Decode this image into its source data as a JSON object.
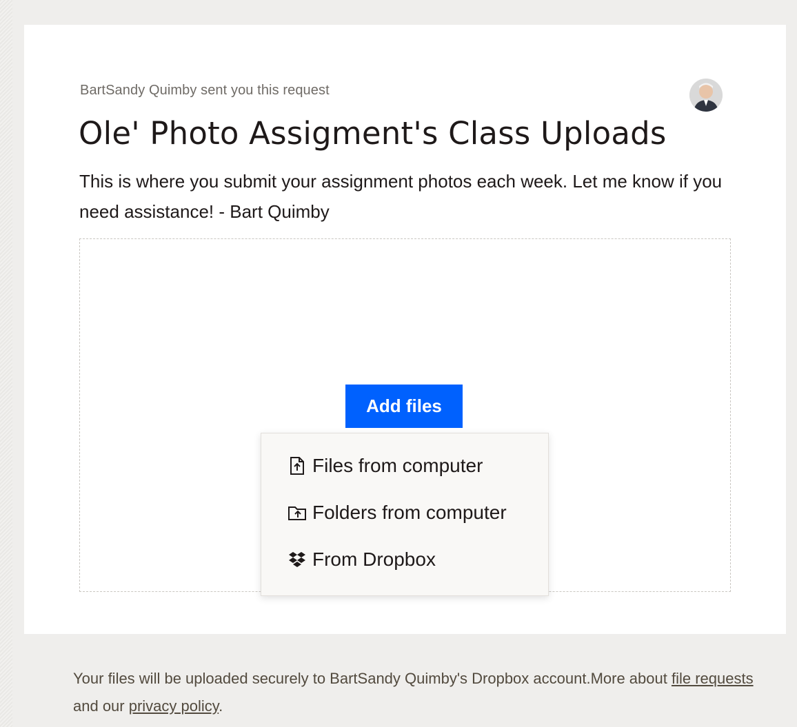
{
  "request": {
    "sender_line": "BartSandy Quimby sent you this request",
    "title": "Ole' Photo Assigment's Class Uploads",
    "description": "This is where you submit your assignment photos each week. Let me know if you need assistance! - Bart Quimby"
  },
  "upload": {
    "add_files_label": "Add files",
    "menu": [
      {
        "label": "Files from computer",
        "icon": "file-upload-icon"
      },
      {
        "label": "Folders from computer",
        "icon": "folder-upload-icon"
      },
      {
        "label": "From Dropbox",
        "icon": "dropbox-icon"
      }
    ]
  },
  "footer": {
    "text_before": "Your files will be uploaded securely to BartSandy Quimby's Dropbox account.More about ",
    "link_file_requests": "file requests",
    "text_middle": " and our ",
    "link_privacy": "privacy policy",
    "text_after": "."
  },
  "colors": {
    "accent": "#0061fe",
    "page_background": "#efeeec",
    "card_background": "#ffffff"
  }
}
